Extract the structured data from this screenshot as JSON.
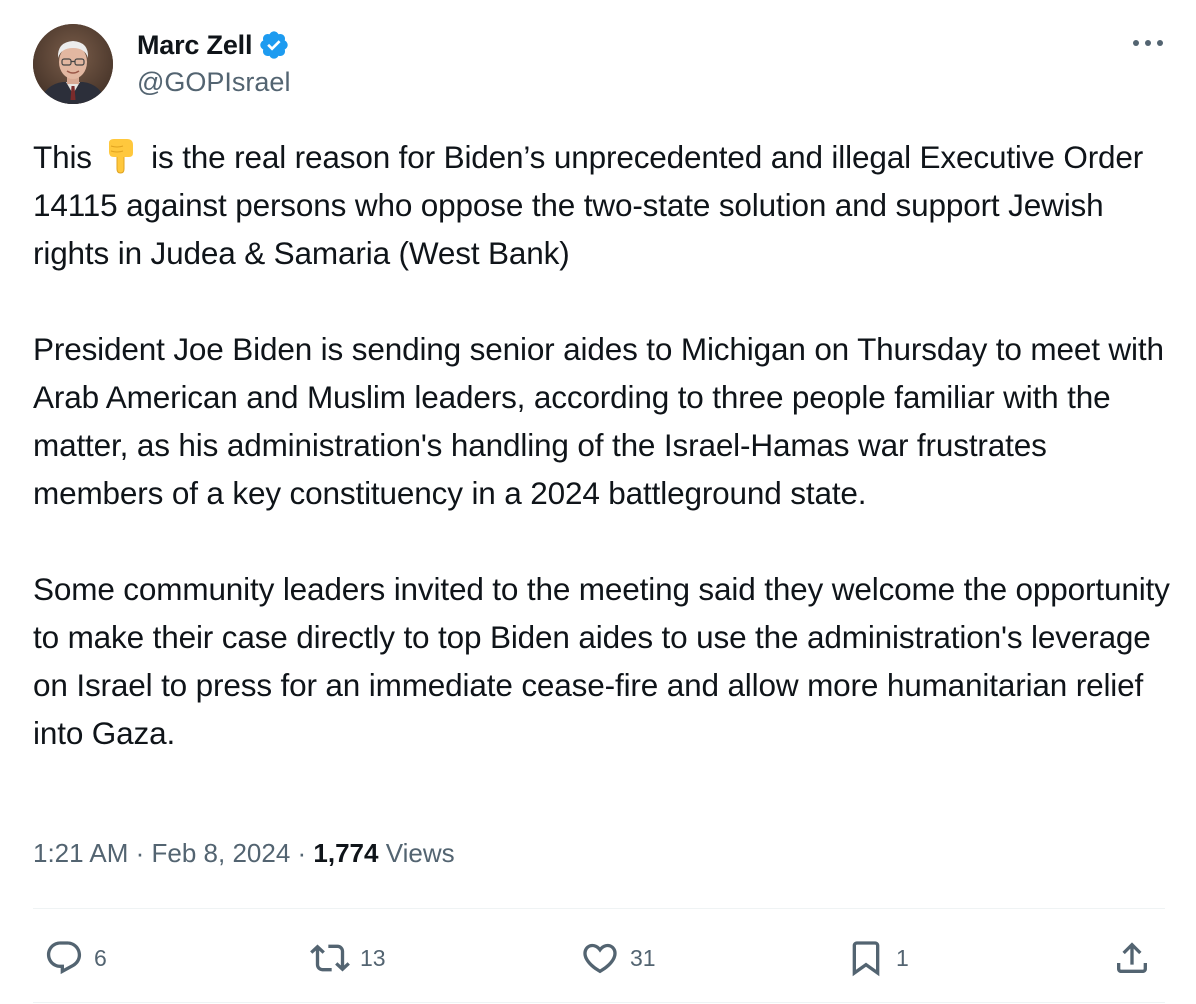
{
  "author": {
    "display_name": "Marc Zell",
    "handle": "@GOPIsrael",
    "verified": true,
    "avatar_icon": "profile-photo"
  },
  "tweet": {
    "p1_a": "This",
    "p1_emoji": "backhand-index-pointing-down",
    "p1_b": "is the real reason for Biden’s unprecedented and illegal Executive Order 14115 against persons who oppose the two-state solution and support Jewish rights in Judea & Samaria (West Bank)",
    "p2": "President Joe Biden is sending senior aides to Michigan on Thursday to meet with Arab American and Muslim leaders, according to three people familiar with the matter, as his administration's handling of the Israel-Hamas war frustrates members of a key constituency in a 2024 battleground state.",
    "p3": "Some community leaders invited to the meeting said they welcome the opportunity to make their case directly to top Biden aides to use the administration's leverage on Israel to press for an immediate cease-fire and allow more humanitarian relief into Gaza."
  },
  "meta": {
    "time": "1:21 AM",
    "sep1": " · ",
    "date": "Feb 8, 2024",
    "sep2": " · ",
    "views_count": "1,774",
    "views_label": " Views"
  },
  "actions": {
    "replies": "6",
    "reposts": "13",
    "likes": "31",
    "bookmarks": "1"
  },
  "colors": {
    "text_primary": "#0f1419",
    "text_secondary": "#536471",
    "verified_blue": "#1d9bf0",
    "divider": "#eff3f4"
  }
}
